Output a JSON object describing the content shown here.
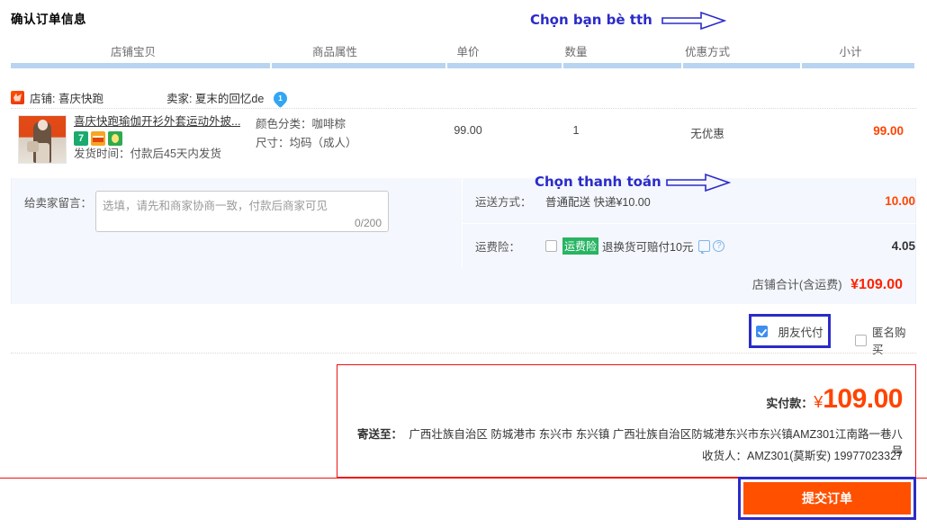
{
  "page_title": "确认订单信息",
  "table": {
    "headers": [
      "店铺宝贝",
      "商品属性",
      "单价",
      "数量",
      "优惠方式",
      "小计"
    ]
  },
  "shop": {
    "logo_icon": "taobao-shop-icon",
    "shop_label": "店铺: 喜庆快跑",
    "seller_label": "卖家: 夏末的回忆de",
    "seller_badge": "1",
    "seller_badge_icon": "seller-rank-drop-icon"
  },
  "product": {
    "thumb_icon": "product-thumbnail",
    "title": "喜庆快跑瑜伽开衫外套运动外披...",
    "badges": [
      {
        "name": "seven-day-return-icon",
        "text": "7"
      },
      {
        "name": "card-payment-icon",
        "text": ""
      },
      {
        "name": "consumer-protection-icon",
        "text": ""
      }
    ],
    "ship_time": "发货时间：付款后45天内发货",
    "attr_color": "颜色分类：咖啡棕",
    "attr_size": "尺寸：均码（成人）",
    "unit_price": "99.00",
    "quantity": "1",
    "promo": "无优惠",
    "subtotal": "99.00"
  },
  "memo": {
    "label": "给卖家留言：",
    "placeholder": "选填，请先和商家协商一致，付款后商家可见",
    "value": "",
    "counter": "0/200"
  },
  "shipping": {
    "label": "运送方式：",
    "value": "普通配送 快递¥10.00",
    "amount": "10.00"
  },
  "insurance": {
    "label": "运费险：",
    "checked": false,
    "tag": "运费险",
    "desc": "退换货可赔付10元",
    "chat_icon": "chat-bubble-icon",
    "help_icon": "question-mark-icon",
    "amount": "4.05"
  },
  "shop_total": {
    "label": "店铺合计(含运费)",
    "amount": "¥109.00"
  },
  "options": {
    "friend_pay_label": "朋友代付",
    "friend_pay_checked": true,
    "anonymous_label": "匿名购买",
    "anonymous_checked": false
  },
  "annotations": [
    {
      "name": "annotation-choose-friend",
      "text": "Chọn bạn bè tth",
      "arrow_icon": "right-arrow-outline-icon"
    },
    {
      "name": "annotation-choose-payment",
      "text": "Chọn thanh toán",
      "arrow_icon": "right-arrow-outline-icon"
    }
  ],
  "summary": {
    "pay_label": "实付款：",
    "currency": "¥",
    "amount": "109.00",
    "address_label": "寄送至：",
    "address": "广西壮族自治区 防城港市 东兴市 东兴镇 广西壮族自治区防城港东兴市东兴镇AMZ301江南路一巷八号",
    "receiver": "收货人：AMZ301(莫斯安) 19977023327"
  },
  "submit": {
    "label": "提交订单"
  },
  "colors": {
    "accent_orange": "#ff5000",
    "price_red": "#ff4400",
    "total_red": "#ff2200",
    "annotation_blue": "#2b2bc9",
    "box_red": "#ee1111",
    "header_rule_blue": "#b9d4f1",
    "shade_bg": "#f4f7fd",
    "checkbox_blue": "#3c8ef0",
    "tag_green": "#28b463"
  }
}
